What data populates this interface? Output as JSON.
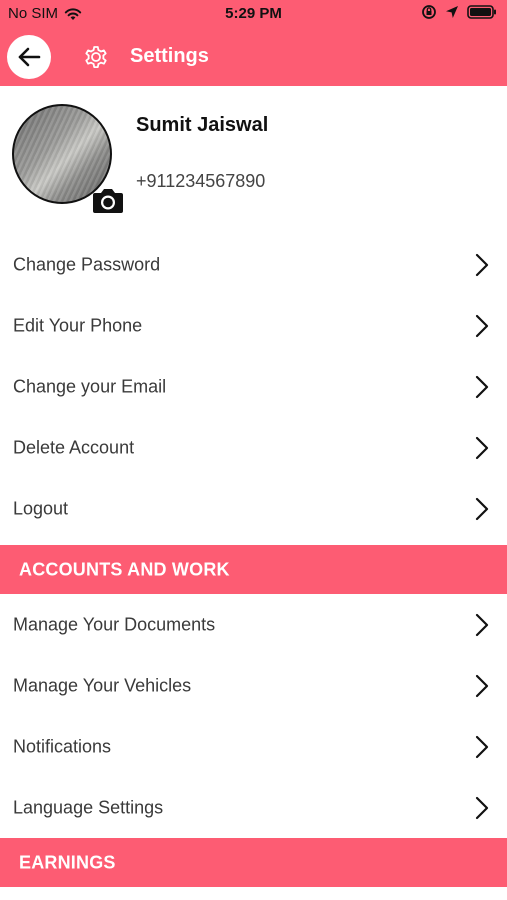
{
  "status_bar": {
    "carrier": "No SIM",
    "time": "5:29 PM",
    "wifi_icon": "wifi-icon",
    "lock_rotation_icon": "orientation-lock-icon",
    "location_icon": "location-arrow-icon",
    "battery_icon": "battery-icon"
  },
  "header": {
    "title": "Settings",
    "back_icon": "back-arrow-icon",
    "title_icon": "gear-icon"
  },
  "profile": {
    "name": "Sumit Jaiswal",
    "phone": "+911234567890",
    "camera_icon": "camera-icon"
  },
  "account_items": [
    {
      "label": "Change Password"
    },
    {
      "label": "Edit Your Phone"
    },
    {
      "label": "Change your Email"
    },
    {
      "label": "Delete Account"
    },
    {
      "label": "Logout"
    }
  ],
  "sections": [
    {
      "label": "ACCOUNTS AND WORK"
    },
    {
      "label": "EARNINGS"
    }
  ],
  "work_items": [
    {
      "label": "Manage Your Documents"
    },
    {
      "label": "Manage Your Vehicles"
    },
    {
      "label": "Notifications"
    },
    {
      "label": "Language Settings"
    }
  ],
  "colors": {
    "accent": "#fd5c73",
    "text": "#3a3a3a",
    "background": "#ffffff"
  }
}
